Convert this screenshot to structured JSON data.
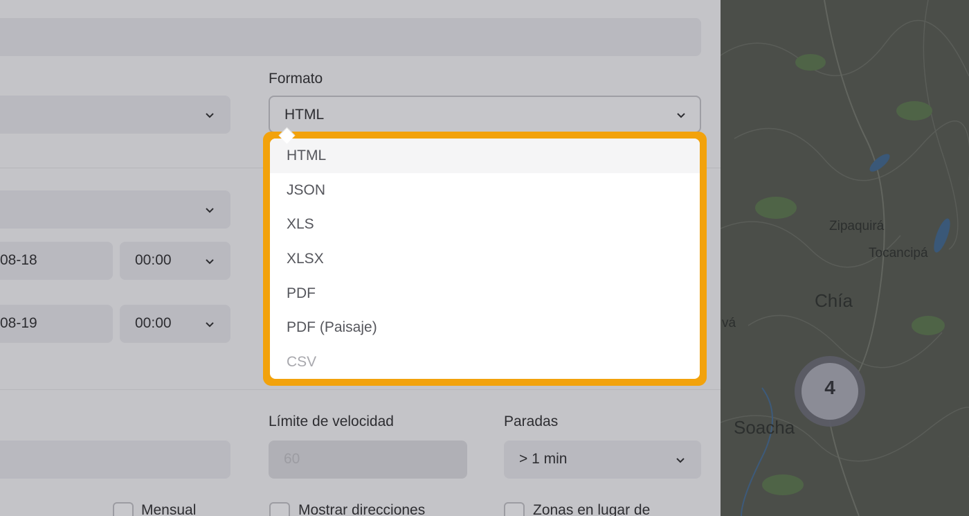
{
  "form": {
    "format_label": "Formato",
    "format_value": "HTML",
    "date_from_partial": "08-18",
    "date_to_partial": "08-19",
    "time_from": "00:00",
    "time_to": "00:00",
    "speed_limit_label": "Límite de velocidad",
    "speed_limit_placeholder": "60",
    "stops_label": "Paradas",
    "stops_value": "> 1 min",
    "monthly_label": "Mensual",
    "show_addresses_label": "Mostrar direcciones",
    "zones_label": "Zonas en lugar de"
  },
  "dropdown": {
    "options": [
      "HTML",
      "JSON",
      "XLS",
      "XLSX",
      "PDF",
      "PDF (Paisaje)",
      "CSV"
    ],
    "selected": "HTML",
    "highlight_color": "#f2a20c"
  },
  "map": {
    "labels": [
      "Zipaquirá",
      "Tocancipá",
      "Chía",
      "Soacha",
      "vá"
    ],
    "cluster_count": "4"
  }
}
